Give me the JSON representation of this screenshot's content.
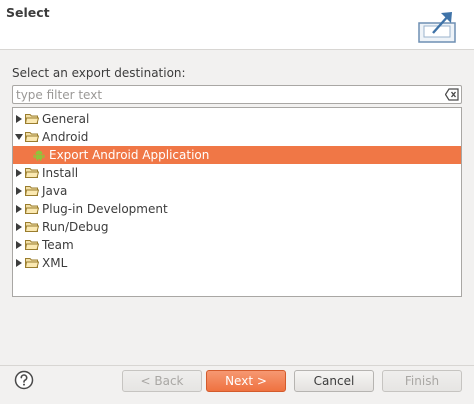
{
  "header": {
    "title": "Select",
    "icon": "export-icon"
  },
  "main": {
    "destination_label": "Select an export destination:",
    "filter_placeholder": "type filter text",
    "filter_value": ""
  },
  "tree": [
    {
      "label": "General",
      "expanded": false,
      "icon": "folder-icon"
    },
    {
      "label": "Android",
      "expanded": true,
      "icon": "folder-icon"
    },
    {
      "label": "Export Android Application",
      "selected": true,
      "icon": "android-icon"
    },
    {
      "label": "Install",
      "expanded": false,
      "icon": "folder-icon"
    },
    {
      "label": "Java",
      "expanded": false,
      "icon": "folder-icon"
    },
    {
      "label": "Plug-in Development",
      "expanded": false,
      "icon": "folder-icon"
    },
    {
      "label": "Run/Debug",
      "expanded": false,
      "icon": "folder-icon"
    },
    {
      "label": "Team",
      "expanded": false,
      "icon": "folder-icon"
    },
    {
      "label": "XML",
      "expanded": false,
      "icon": "folder-icon"
    }
  ],
  "buttons": {
    "back": "< Back",
    "next": "Next >",
    "cancel": "Cancel",
    "finish": "Finish"
  },
  "colors": {
    "selection": "#f07746",
    "primary_button": "#ef7240"
  }
}
